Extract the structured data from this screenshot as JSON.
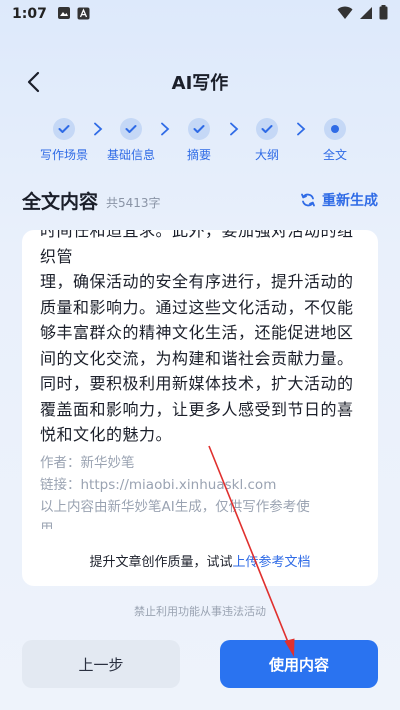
{
  "status": {
    "time": "1:07",
    "icons": [
      "image-icon",
      "a-badge-icon",
      "wifi-icon",
      "signal-icon",
      "battery-icon"
    ]
  },
  "header": {
    "title": "AI写作",
    "back_icon": "chevron-left-icon"
  },
  "stepper": {
    "steps": [
      {
        "label": "写作场景",
        "state": "done"
      },
      {
        "label": "基础信息",
        "state": "done"
      },
      {
        "label": "摘要",
        "state": "done"
      },
      {
        "label": "大纲",
        "state": "done"
      },
      {
        "label": "全文",
        "state": "current"
      }
    ]
  },
  "section": {
    "title": "全文内容",
    "word_count": "共5413字",
    "regen_label": "重新生成"
  },
  "content": {
    "partial_line": "时间任和适宜求。此外，要加强对活动的组织管",
    "body": "理，确保活动的安全有序进行，提升活动的质量和影响力。通过这些文化活动，不仅能够丰富群众的精神文化生活，还能促进地区间的文化交流，为构建和谐社会贡献力量。同时，要积极利用新媒体技术，扩大活动的覆盖面和影响力，让更多人感受到节日的喜悦和文化的魅力。",
    "author": "作者：新华妙笔",
    "link": "链接：https://miaobi.xinhuaskl.com",
    "generated_note": "以上内容由新华妙笔AI生成，仅供写作参考使",
    "cut_line": "用"
  },
  "card_footer": {
    "prefix": "提升文章创作质量，试试",
    "link": "上传参考文档"
  },
  "disclaimer": "禁止利用功能从事违法活动",
  "buttons": {
    "prev": "上一步",
    "use": "使用内容"
  },
  "colors": {
    "accent": "#2f6be6",
    "primary_button": "#2a73f0",
    "annotation": "#e0302e"
  }
}
